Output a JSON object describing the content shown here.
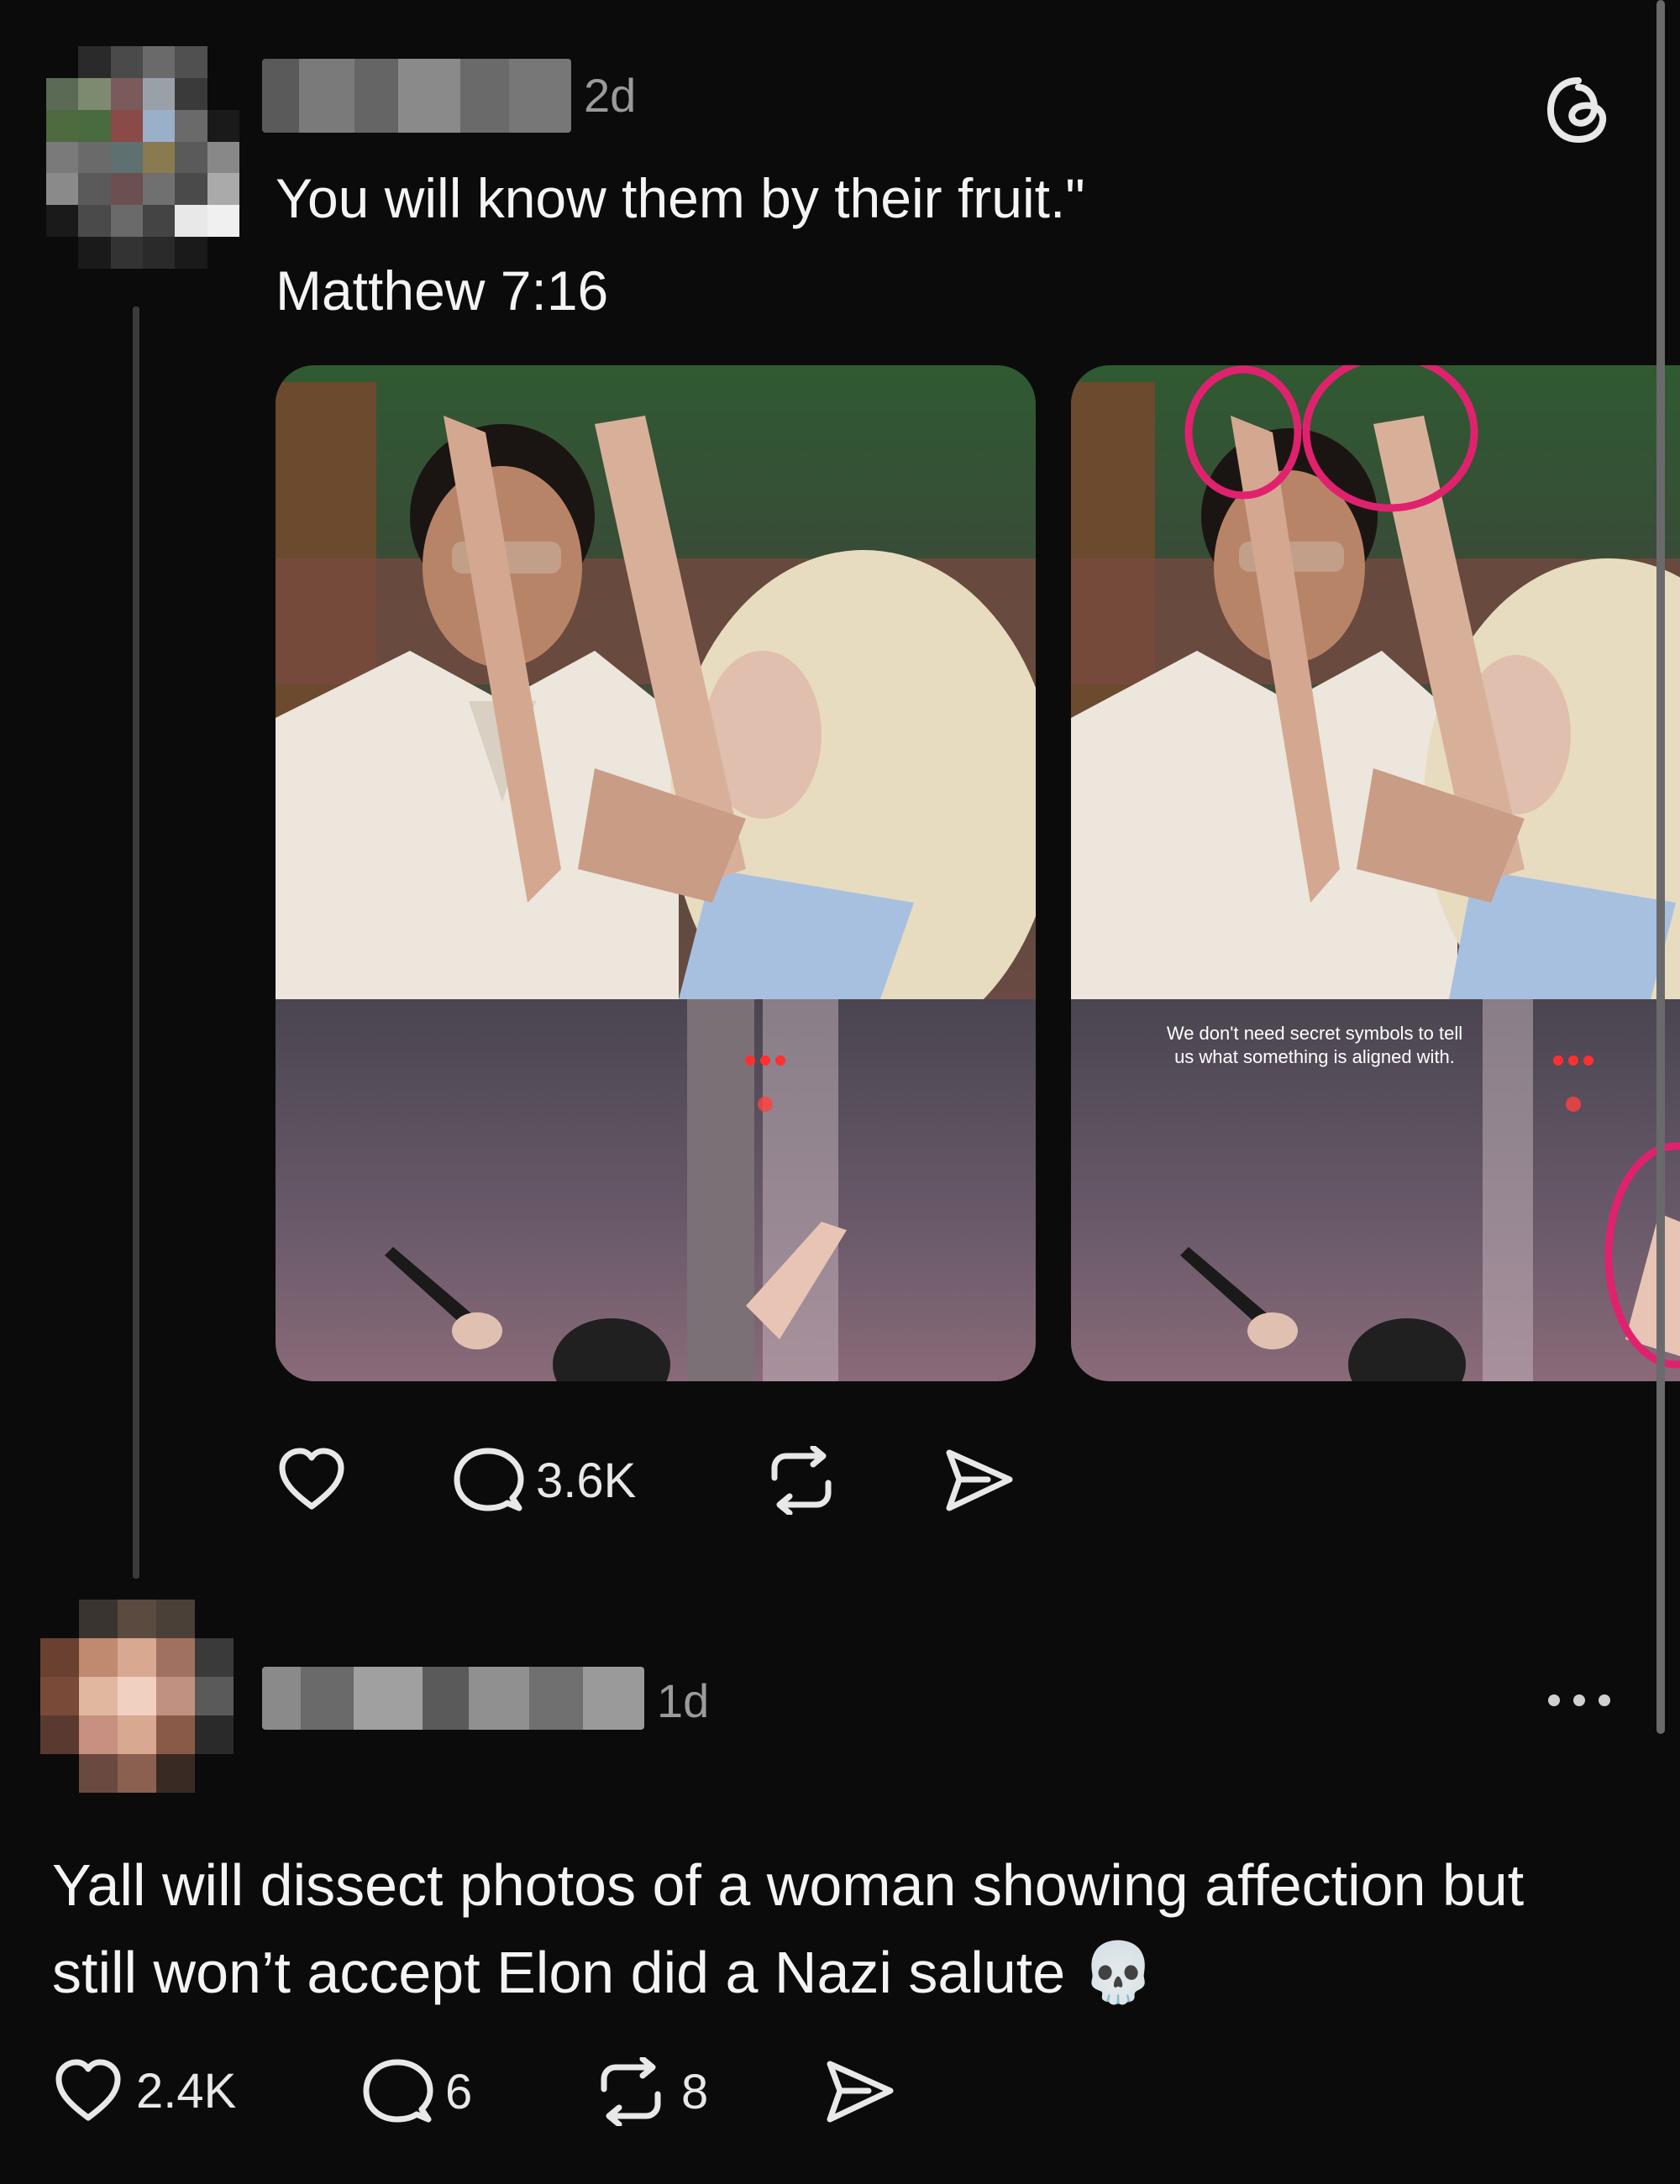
{
  "post": {
    "time": "2d",
    "text_line1": "You will know them by their fruit.\"",
    "text_line2": "Matthew 7:16",
    "image2_caption": "We don't need secret symbols to tell us what something is aligned with.",
    "actions": {
      "like_count": "",
      "comment_count": "3.6K",
      "repost_count": "",
      "share_count": ""
    },
    "app_icon": "threads-logo-icon"
  },
  "reply": {
    "time": "1d",
    "text_line1": "Yall will dissect photos of a woman showing affection but",
    "text_line2": "still won’t accept Elon did a Nazi salute 💀",
    "actions": {
      "like_count": "2.4K",
      "comment_count": "6",
      "repost_count": "8"
    },
    "more_icon": "more-horizontal-icon"
  },
  "colors": {
    "background": "#0b0b0c",
    "text": "#f2f2f2",
    "muted": "#9a9a9a",
    "annotation": "#e0226e"
  }
}
